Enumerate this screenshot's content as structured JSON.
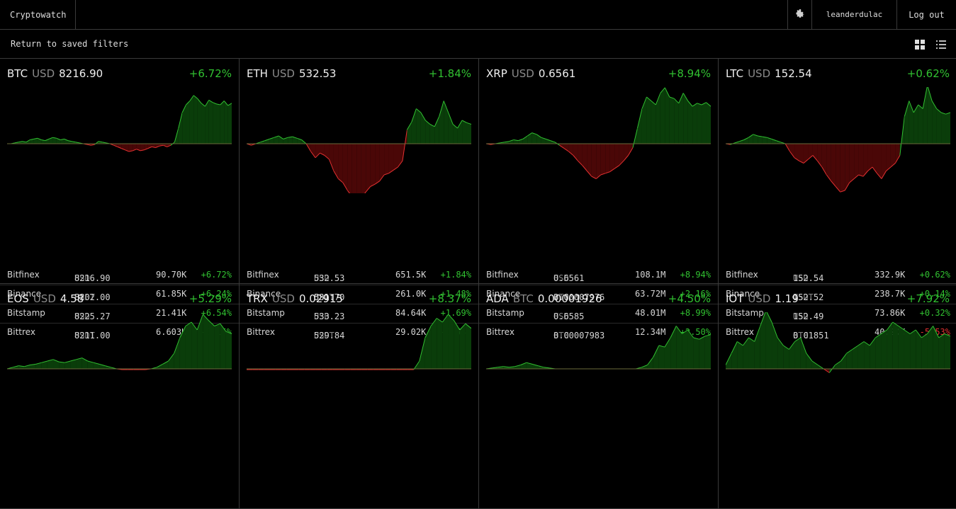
{
  "app": {
    "title": "Cryptowatch",
    "username": "leanderdulac",
    "logout": "Log out"
  },
  "toolbar": {
    "back_label": "Return to saved filters"
  },
  "colors": {
    "up": "#31c131",
    "down": "#e53131",
    "up_fill": "#0a3d0a",
    "down_fill": "#4a0707"
  },
  "icons": [
    "gear-icon",
    "grid-view-icon",
    "list-view-icon"
  ],
  "panels": [
    {
      "symbol": "BTC",
      "quote": "USD",
      "price": "8216.90",
      "change": "+6.72%",
      "dir": "up",
      "spark": [
        0,
        0,
        1,
        2,
        3,
        2,
        5,
        6,
        7,
        5,
        4,
        6,
        8,
        7,
        5,
        6,
        4,
        3,
        2,
        1,
        0,
        -1,
        -2,
        -1,
        3,
        2,
        1,
        0,
        -2,
        -4,
        -6,
        -8,
        -10,
        -9,
        -7,
        -9,
        -8,
        -6,
        -4,
        -5,
        -3,
        -2,
        -4,
        -2,
        2,
        20,
        40,
        50,
        55,
        62,
        58,
        52,
        48,
        56,
        53,
        51,
        50,
        55,
        49,
        52
      ],
      "rows": [
        {
          "exchange": "Bitfinex",
          "quote": "USD",
          "price": "8216.90",
          "volume": "90.70K",
          "change": "+6.72%",
          "dir": "up"
        },
        {
          "exchange": "Binance",
          "quote": "USDT",
          "price": "8202.00",
          "volume": "61.85K",
          "change": "+6.24%",
          "dir": "up"
        },
        {
          "exchange": "Bitstamp",
          "quote": "USD",
          "price": "8225.27",
          "volume": "21.41K",
          "change": "+6.54%",
          "dir": "up"
        },
        {
          "exchange": "Bittrex",
          "quote": "USDT",
          "price": "8211.00",
          "volume": "6.603K",
          "change": "+6.15%",
          "dir": "up"
        }
      ]
    },
    {
      "symbol": "ETH",
      "quote": "USD",
      "price": "532.53",
      "change": "+1.84%",
      "dir": "up",
      "spark": [
        0,
        -2,
        0,
        2,
        4,
        6,
        8,
        10,
        6,
        8,
        9,
        7,
        5,
        0,
        -10,
        -18,
        -12,
        -15,
        -20,
        -35,
        -45,
        -50,
        -60,
        -68,
        -66,
        -70,
        -62,
        -55,
        -52,
        -48,
        -40,
        -38,
        -34,
        -30,
        -22,
        18,
        28,
        45,
        40,
        30,
        25,
        22,
        35,
        55,
        40,
        25,
        20,
        30,
        27,
        25
      ],
      "rows": [
        {
          "exchange": "Bitfinex",
          "quote": "USD",
          "price": "532.53",
          "volume": "651.5K",
          "change": "+1.84%",
          "dir": "up"
        },
        {
          "exchange": "Binance",
          "quote": "USDT",
          "price": "531.70",
          "volume": "261.0K",
          "change": "+1.48%",
          "dir": "up"
        },
        {
          "exchange": "Bitstamp",
          "quote": "USD",
          "price": "533.23",
          "volume": "84.64K",
          "change": "+1.69%",
          "dir": "up"
        },
        {
          "exchange": "Bittrex",
          "quote": "USDT",
          "price": "529.84",
          "volume": "29.02K",
          "change": "+1.54%",
          "dir": "up"
        }
      ]
    },
    {
      "symbol": "XRP",
      "quote": "USD",
      "price": "0.6561",
      "change": "+8.94%",
      "dir": "up",
      "spark": [
        0,
        -1,
        0,
        1,
        2,
        3,
        5,
        4,
        6,
        10,
        14,
        12,
        8,
        6,
        4,
        2,
        -2,
        -6,
        -10,
        -15,
        -22,
        -28,
        -35,
        -42,
        -45,
        -40,
        -38,
        -36,
        -32,
        -28,
        -22,
        -15,
        -5,
        20,
        45,
        60,
        55,
        50,
        65,
        72,
        60,
        58,
        52,
        65,
        55,
        48,
        52,
        50,
        53,
        48
      ],
      "rows": [
        {
          "exchange": "Bitfinex",
          "quote": "USD",
          "price": "0.6561",
          "volume": "108.1M",
          "change": "+8.94%",
          "dir": "up"
        },
        {
          "exchange": "Binance",
          "quote": "BTC",
          "price": "0.00007976",
          "volume": "63.72M",
          "change": "+2.16%",
          "dir": "up"
        },
        {
          "exchange": "Bitstamp",
          "quote": "USD",
          "price": "0.6585",
          "volume": "48.01M",
          "change": "+8.99%",
          "dir": "up"
        },
        {
          "exchange": "Bittrex",
          "quote": "BTC",
          "price": "0.00007983",
          "volume": "12.34M",
          "change": "+2.50%",
          "dir": "up"
        }
      ]
    },
    {
      "symbol": "LTC",
      "quote": "USD",
      "price": "152.54",
      "change": "+0.62%",
      "dir": "up",
      "spark": [
        0,
        -1,
        1,
        3,
        5,
        8,
        12,
        10,
        9,
        8,
        6,
        4,
        2,
        0,
        -10,
        -18,
        -22,
        -25,
        -20,
        -15,
        -22,
        -30,
        -40,
        -48,
        -55,
        -62,
        -60,
        -50,
        -45,
        -40,
        -42,
        -35,
        -30,
        -38,
        -45,
        -35,
        -30,
        -25,
        -15,
        35,
        55,
        40,
        50,
        45,
        75,
        55,
        45,
        40,
        38,
        40
      ],
      "rows": [
        {
          "exchange": "Bitfinex",
          "quote": "USD",
          "price": "152.54",
          "volume": "332.9K",
          "change": "+0.62%",
          "dir": "up"
        },
        {
          "exchange": "Binance",
          "quote": "USDT",
          "price": "152.52",
          "volume": "238.7K",
          "change": "+0.14%",
          "dir": "up"
        },
        {
          "exchange": "Bitstamp",
          "quote": "USD",
          "price": "152.49",
          "volume": "73.86K",
          "change": "+0.32%",
          "dir": "up"
        },
        {
          "exchange": "Bittrex",
          "quote": "BTC",
          "price": "0.01851",
          "volume": "40.20K",
          "change": "-5.53%",
          "dir": "down"
        }
      ]
    },
    {
      "symbol": "EOS",
      "quote": "USD",
      "price": "4.58",
      "change": "+5.29%",
      "dir": "up",
      "spark": [
        0,
        2,
        4,
        3,
        5,
        6,
        8,
        10,
        12,
        9,
        8,
        10,
        12,
        14,
        10,
        8,
        6,
        4,
        2,
        0,
        -1,
        -1,
        -1,
        -1,
        -1,
        0,
        2,
        6,
        10,
        20,
        40,
        55,
        60,
        50,
        70,
        62,
        55,
        58,
        48,
        45
      ],
      "rows": []
    },
    {
      "symbol": "TRX",
      "quote": "USD",
      "price": "0.02915",
      "change": "+8.37%",
      "dir": "up",
      "spark": [
        -1,
        -1,
        -1,
        -1,
        -1,
        -1,
        -1,
        -1,
        -1,
        -1,
        -1,
        -1,
        -1,
        -1,
        -1,
        -1,
        -1,
        -1,
        -1,
        -1,
        -1,
        -1,
        -1,
        -1,
        -1,
        -1,
        -1,
        -1,
        -1,
        -1,
        10,
        40,
        55,
        65,
        60,
        70,
        62,
        50,
        58,
        52
      ],
      "rows": []
    },
    {
      "symbol": "ADA",
      "quote": "BTC",
      "price": "0.00001926",
      "change": "+4.50%",
      "dir": "up",
      "spark": [
        0,
        1,
        2,
        3,
        2,
        3,
        5,
        8,
        6,
        4,
        2,
        1,
        0,
        0,
        0,
        0,
        0,
        0,
        0,
        0,
        0,
        0,
        0,
        0,
        0,
        0,
        0,
        2,
        5,
        15,
        30,
        28,
        40,
        55,
        45,
        50,
        40,
        38,
        42,
        44
      ],
      "rows": []
    },
    {
      "symbol": "IOT",
      "quote": "USD",
      "price": "1.19",
      "change": "+7.92%",
      "dir": "up",
      "spark": [
        5,
        20,
        35,
        30,
        40,
        35,
        55,
        75,
        60,
        40,
        30,
        25,
        35,
        40,
        20,
        10,
        5,
        0,
        -5,
        5,
        10,
        20,
        25,
        30,
        35,
        30,
        40,
        45,
        50,
        60,
        55,
        50,
        45,
        50,
        40,
        45,
        55,
        40,
        45,
        42
      ],
      "rows": []
    }
  ]
}
